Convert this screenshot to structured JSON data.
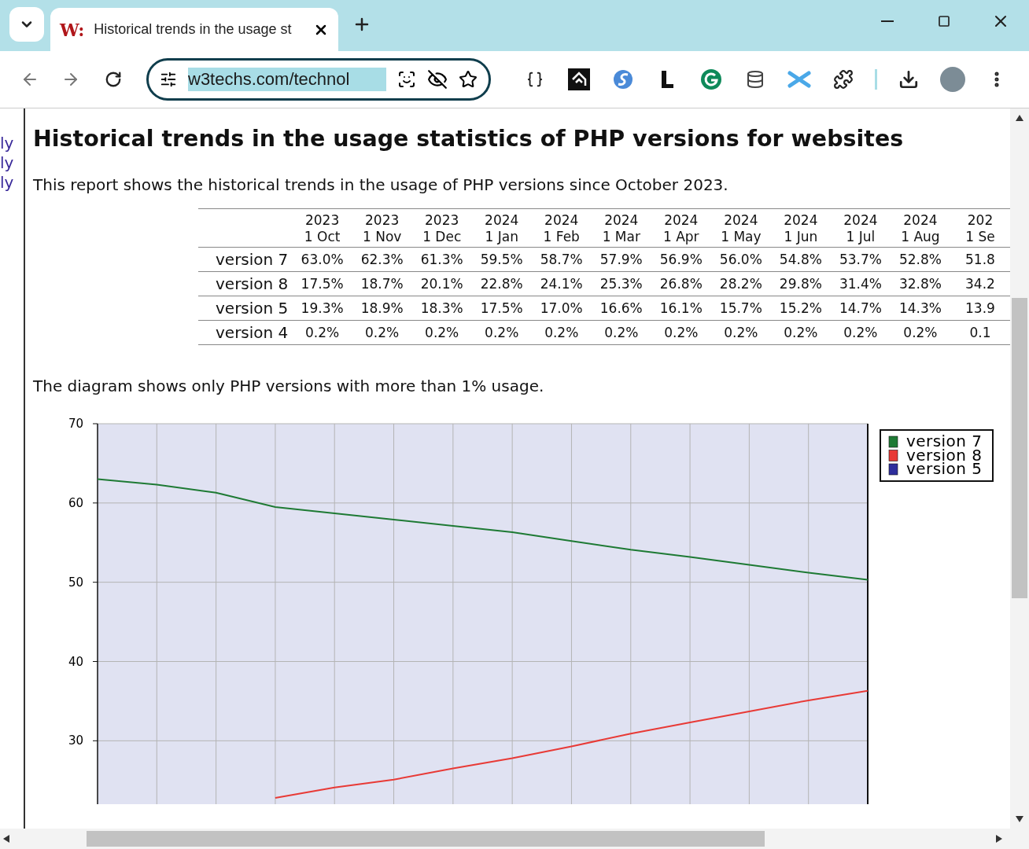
{
  "browser": {
    "tab": {
      "favicon": "W:",
      "title": "Historical trends in the usage st",
      "selected": true
    },
    "address": "w3techs.com/technol"
  },
  "sidebar": {
    "links": [
      "ly",
      "ly",
      "ly"
    ]
  },
  "page": {
    "title": "Historical trends in the usage statistics of PHP versions for websites",
    "intro": "This report shows the historical trends in the usage of PHP versions since October 2023.",
    "table": {
      "columns": [
        {
          "year": "2023",
          "day": "1 Oct"
        },
        {
          "year": "2023",
          "day": "1 Nov"
        },
        {
          "year": "2023",
          "day": "1 Dec"
        },
        {
          "year": "2024",
          "day": "1 Jan"
        },
        {
          "year": "2024",
          "day": "1 Feb"
        },
        {
          "year": "2024",
          "day": "1 Mar"
        },
        {
          "year": "2024",
          "day": "1 Apr"
        },
        {
          "year": "2024",
          "day": "1 May"
        },
        {
          "year": "2024",
          "day": "1 Jun"
        },
        {
          "year": "2024",
          "day": "1 Jul"
        },
        {
          "year": "2024",
          "day": "1 Aug"
        },
        {
          "year": "202",
          "day": "1 Se"
        }
      ],
      "rows": [
        {
          "label": "version 7",
          "cells": [
            "63.0%",
            "62.3%",
            "61.3%",
            "59.5%",
            "58.7%",
            "57.9%",
            "56.9%",
            "56.0%",
            "54.8%",
            "53.7%",
            "52.8%",
            "51.8"
          ]
        },
        {
          "label": "version 8",
          "cells": [
            "17.5%",
            "18.7%",
            "20.1%",
            "22.8%",
            "24.1%",
            "25.3%",
            "26.8%",
            "28.2%",
            "29.8%",
            "31.4%",
            "32.8%",
            "34.2"
          ]
        },
        {
          "label": "version 5",
          "cells": [
            "19.3%",
            "18.9%",
            "18.3%",
            "17.5%",
            "17.0%",
            "16.6%",
            "16.1%",
            "15.7%",
            "15.2%",
            "14.7%",
            "14.3%",
            "13.9"
          ]
        },
        {
          "label": "version 4",
          "cells": [
            "0.2%",
            "0.2%",
            "0.2%",
            "0.2%",
            "0.2%",
            "0.2%",
            "0.2%",
            "0.2%",
            "0.2%",
            "0.2%",
            "0.2%",
            "0.1"
          ]
        }
      ]
    },
    "note": "The diagram shows only PHP versions with more than 1% usage.",
    "chart": {
      "chart_data": {
        "type": "line",
        "ylim": [
          22,
          70
        ],
        "yticks": [
          30,
          40,
          50,
          60,
          70
        ],
        "grid": true,
        "legend": true,
        "series": [
          {
            "name": "version 7",
            "color": "#1e7a34",
            "values": [
              63.0,
              62.3,
              61.3,
              59.5,
              58.7,
              57.9,
              57.1,
              56.3,
              55.2,
              54.1,
              53.2,
              52.2,
              51.2,
              50.3
            ]
          },
          {
            "name": "version 8",
            "color": "#e83a36",
            "values": [
              null,
              null,
              null,
              22.8,
              24.1,
              25.1,
              26.5,
              27.8,
              29.3,
              30.9,
              32.3,
              33.7,
              35.1,
              36.3
            ]
          },
          {
            "name": "version 5",
            "color": "#2e2e9c",
            "values": [
              null,
              null,
              null,
              null,
              null,
              null,
              null,
              null,
              null,
              null,
              null,
              null,
              null,
              null
            ]
          }
        ]
      }
    }
  }
}
